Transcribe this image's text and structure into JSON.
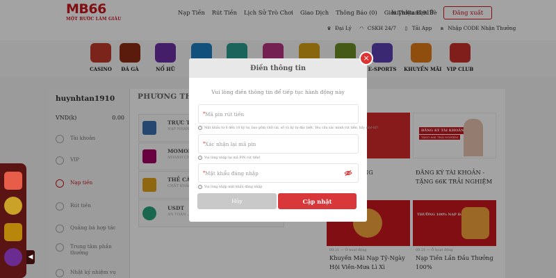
{
  "brand": {
    "logo": "MB66",
    "tagline": "MỘT BƯỚC LÀM GIÀU"
  },
  "header": {
    "nav": [
      "Nạp Tiền",
      "Rút Tiền",
      "Lịch Sử Trò Chơi",
      "Giao Dịch",
      "Thông Báo (0)",
      "Giới Thiệu Bạn Bè"
    ],
    "username": "huynhtan1910",
    "logout_label": "Đăng xuất",
    "subnav": [
      {
        "label": "Đại Lý",
        "icon": "agent-icon"
      },
      {
        "label": "CSKH 24/7",
        "icon": "headset-icon"
      },
      {
        "label": "Tải App",
        "icon": "phone-icon"
      },
      {
        "label": "Nhập CODE Nhận Thưởng",
        "icon": "gift-icon"
      }
    ]
  },
  "games": [
    {
      "label": "CASINO",
      "icon": "casino-icon",
      "color": "#c0392b"
    },
    {
      "label": "ĐÁ GÀ",
      "icon": "rooster-icon",
      "color": "#8e2b14"
    },
    {
      "label": "NỔ HŨ",
      "icon": "slot-icon",
      "color": "#6b2fa3"
    },
    {
      "label": "",
      "icon": "fish-icon",
      "color": "#1e7fc4"
    },
    {
      "label": "",
      "icon": "lottery-icon",
      "color": "#2a9d8f"
    },
    {
      "label": "",
      "icon": "card-icon",
      "color": "#b83280"
    },
    {
      "label": "",
      "icon": "sport-icon",
      "color": "#d4a017"
    },
    {
      "label": "",
      "icon": "billiard-icon",
      "color": "#6b8e23"
    },
    {
      "label": "E-SPORTS",
      "icon": "esports-icon",
      "color": "#5b3fb5"
    },
    {
      "label": "KHUYẾN MÃI",
      "icon": "promo-gift-icon",
      "color": "#e07b15"
    },
    {
      "label": "VIP CLUB",
      "icon": "vip-club-icon",
      "color": "#c9302c"
    }
  ],
  "account": {
    "username": "huynhtan1910",
    "currency": "VND(k)",
    "balance": "0.00",
    "menu": [
      {
        "label": "Tài khoản",
        "active": false
      },
      {
        "label": "VIP",
        "active": false
      },
      {
        "label": "Nạp tiền",
        "active": true
      },
      {
        "label": "Rút tiền",
        "active": false
      },
      {
        "label": "Quảng bá hợp tác",
        "active": false
      },
      {
        "label": "Trung tâm phần thưởng",
        "active": false
      },
      {
        "label": "Nhật ký nhiệm vụ",
        "active": false
      }
    ]
  },
  "deposit": {
    "title": "PHƯƠNG THỨC",
    "methods": [
      {
        "name": "TRỰC TUYẾN",
        "desc": "NẠP NHANH ... ĐƠN",
        "logo_color": "#3a6fb0"
      },
      {
        "name": "MOMOPAY",
        "desc": "NHANH CHÓNG ... DÀNG",
        "logo_color": "#a50064"
      },
      {
        "name": "THẺ CÀO",
        "desc": "CHẤT KHẮC ... TRÊN THỊ TRƯỜNG",
        "logo_color": "#e0a21c"
      },
      {
        "name": "USDT",
        "desc": "AN TOÀN ... NẠP RÚT TÀ...",
        "logo_color": "#26a17b"
      }
    ]
  },
  "promos": [
    {
      "title": "... LẦN - TẶNG",
      "meta": "",
      "color": "#d42a2a"
    },
    {
      "title": "ĐĂNG KÝ TÀI KHOẢN - TẶNG 66K TRẢI NGHIỆM",
      "meta": "",
      "color": "#d42a2a",
      "banner": "ĐĂNG KÝ TÀI KHOẢN",
      "banner2": "TẶNG 66K TRẢI NGHIỆM"
    },
    {
      "title": "Khuyến Mãi Nạp Tỷ-Ngày Hội Viên-Mưa Lì Xì",
      "meta": "09.21 — Ở hoạt động",
      "color": "#c8161d"
    },
    {
      "title": "Nạp Tiền Lần Đầu Thưởng 100%",
      "meta": "09.21 — Ở hoạt động",
      "color": "#c8161d",
      "banner": "THƯỞNG 100% NẠP ĐẦU"
    }
  ],
  "modal": {
    "title": "Điền thông tin",
    "subtitle": "Vui lòng điền thông tin để tiếp tục hành động này",
    "fields": [
      {
        "placeholder": "Mã pin rút tiền",
        "value": "",
        "hint": "Mật khẩu từ 6 đến 10 ký tự, bao gồm chữ cái, số và ký tự đặc biệt. Yêu cầu xác minh rút tiền, hãy nhớ kỹ!"
      },
      {
        "placeholder": "Xác nhận lại mã pin",
        "value": "",
        "hint": "Vui lòng nhập lại mã PIN rút tiền!"
      },
      {
        "placeholder": "Mật khẩu đăng nhập",
        "value": "",
        "hint": "Vui lòng nhập mật khẩu đăng nhập"
      }
    ],
    "cancel_label": "Hủy",
    "submit_label": "Cập nhật",
    "close_symbol": "×"
  }
}
